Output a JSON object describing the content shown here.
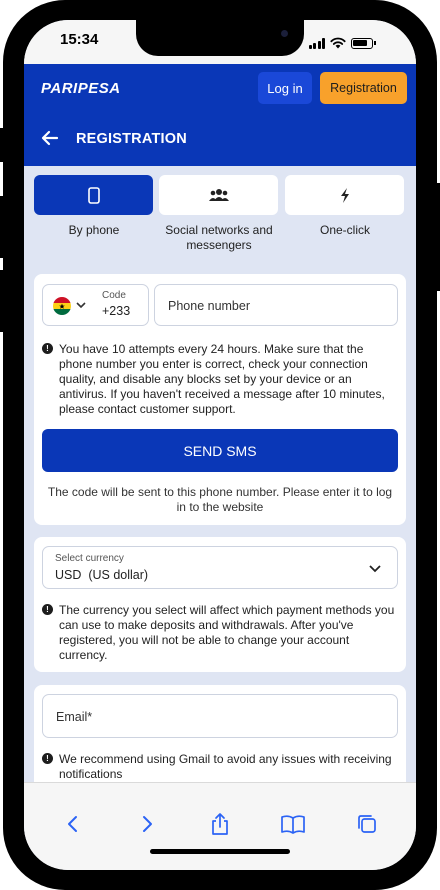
{
  "status_bar": {
    "time": "15:34"
  },
  "brand": {
    "logo_text": "PARIPESA",
    "primary_color": "#0a37b7",
    "accent_color": "#f8a12b"
  },
  "topbar": {
    "login_label": "Log in",
    "registration_label": "Registration"
  },
  "header": {
    "title": "REGISTRATION",
    "back_icon": "arrow-left-icon"
  },
  "tabs": [
    {
      "label": "By phone",
      "icon": "phone-icon",
      "active": true
    },
    {
      "label": "Social networks and messengers",
      "icon": "users-icon",
      "active": false
    },
    {
      "label": "One-click",
      "icon": "lightning-icon",
      "active": false
    }
  ],
  "phone_form": {
    "country_flag": "ghana-flag-icon",
    "code_label": "Code",
    "code_value": "+233",
    "phone_placeholder": "Phone number",
    "info_text": "You have 10 attempts every 24 hours. Make sure that the phone number you enter is correct, check your connection quality, and disable any blocks set by your device or an antivirus. If you haven't received a message after 10 minutes, please contact customer support.",
    "send_label": "SEND SMS",
    "note_text": "The code will be sent to this phone number. Please enter it to log in to the website"
  },
  "currency_form": {
    "label": "Select currency",
    "value": "USD  (US dollar)",
    "info_text": "The currency you select will affect which payment methods you can use to make deposits and withdrawals. After you've registered, you will not be able to change your account currency."
  },
  "email_form": {
    "placeholder": "Email*",
    "info_text": "We recommend using Gmail to avoid any issues with receiving notifications"
  },
  "browser_toolbar": [
    "back-icon",
    "forward-icon",
    "share-icon",
    "bookmarks-icon",
    "tabs-icon"
  ]
}
